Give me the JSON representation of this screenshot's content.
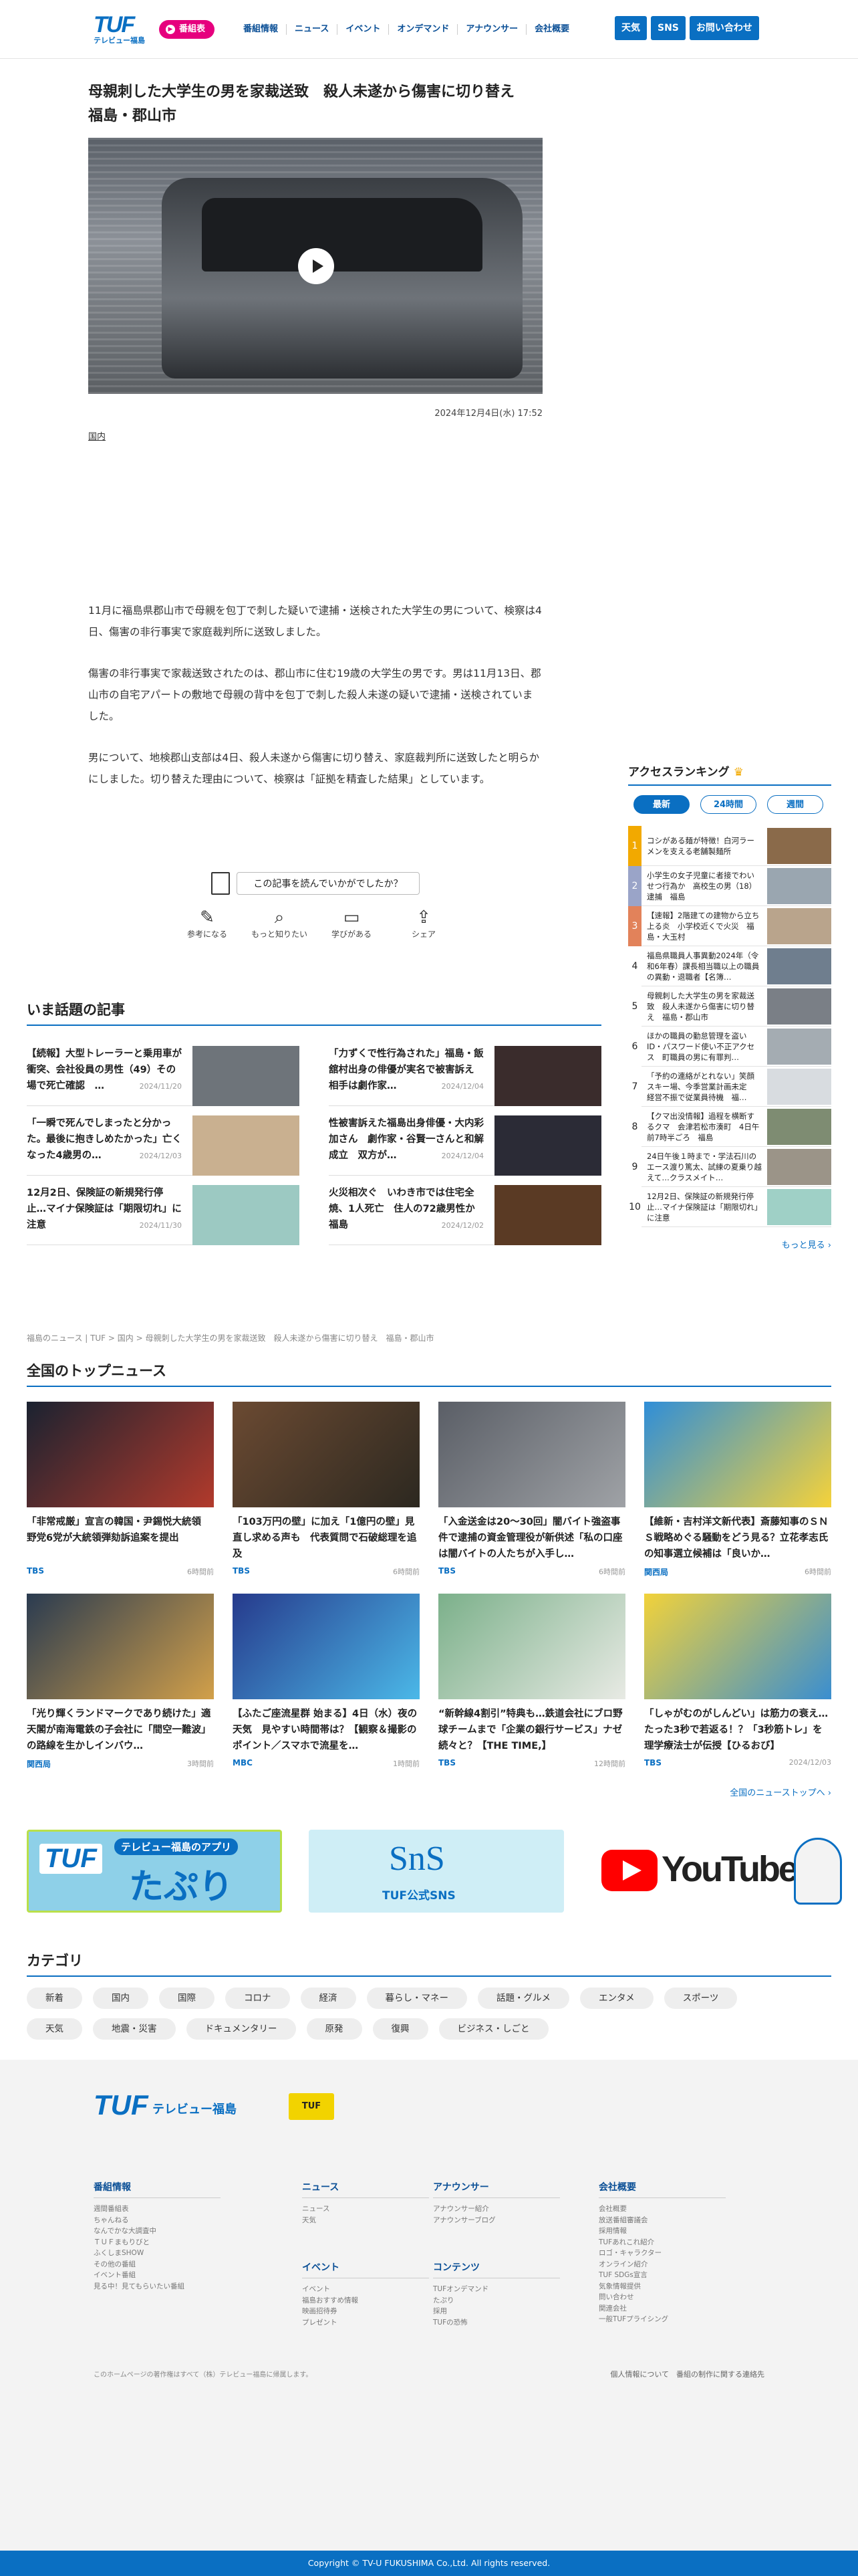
{
  "header": {
    "logo_text": "TUF",
    "logo_sub": "テレビュー福島",
    "program_button": "番組表",
    "nav": [
      "番組情報",
      "ニュース",
      "イベント",
      "オンデマンド",
      "アナウンサー",
      "会社概要"
    ],
    "buttons": [
      "天気",
      "SNS",
      "お問い合わせ"
    ]
  },
  "article": {
    "title": "母親刺した大学生の男を家裁送致　殺人未遂から傷害に切り替え　福島・郡山市",
    "date": "2024年12月4日(水) 17:52",
    "tag": "国内",
    "paragraphs": [
      "11月に福島県郡山市で母親を包丁で刺した疑いで逮捕・送検された大学生の男について、検察は4日、傷害の非行事実で家庭裁判所に送致しました。",
      "傷害の非行事実で家裁送致されたのは、郡山市に住む19歳の大学生の男です。男は11月13日、郡山市の自宅アパートの敷地で母親の背中を包丁で刺した殺人未遂の疑いで逮捕・送検されていました。",
      "男について、地検郡山支部は4日、殺人未遂から傷害に切り替え、家庭裁判所に送致したと明らかにしました。切り替えた理由について、検察は「証拠を精査した結果」としています。"
    ]
  },
  "reaction": {
    "question": "この記事を読んでいかがでしたか？",
    "options": [
      "参考になる",
      "もっと知りたい",
      "学びがある",
      "シェア"
    ]
  },
  "hot": {
    "title": "いま話題の記事",
    "items": [
      {
        "text": "【続報】大型トレーラーと乗用車が衝突、会社役員の男性（49）その場で死亡確認　…",
        "date": "2024/11/20"
      },
      {
        "text": "「力ずくで性行為された」福島・飯舘村出身の俳優が実名で被害訴え　相手は劇作家…",
        "date": "2024/12/04"
      },
      {
        "text": "「一瞬で死んでしまったと分かった。最後に抱きしめたかった」亡くなった4歳男の…",
        "date": "2024/12/03"
      },
      {
        "text": "性被害訴えた福島出身俳優・大内彩加さん　劇作家・谷賢一さんと和解成立　双方が…",
        "date": "2024/12/04"
      },
      {
        "text": "12月2日、保険証の新規発行停止…マイナ保険証は「期限切れ」に注意",
        "date": "2024/11/30"
      },
      {
        "text": "火災相次ぐ　いわき市では住宅全焼、1人死亡　住人の72歳男性か　福島",
        "date": "2024/12/02"
      }
    ]
  },
  "breadcrumb": "福島のニュース | TUF > 国内 > 母親刺した大学生の男を家裁送致　殺人未遂から傷害に切り替え　福島・郡山市",
  "ranking": {
    "title": "アクセスランキング",
    "tabs": [
      "最新",
      "24時間",
      "週間"
    ],
    "items": [
      {
        "n": "1",
        "text": "コシがある麺が特徴！白河ラーメンを支える老舗製麺所",
        "color": "#f2a900"
      },
      {
        "n": "2",
        "text": "小学生の女子児童に者接でわいせつ行為か　高校生の男（18）逮捕　福島",
        "color": "#9aa4c8"
      },
      {
        "n": "3",
        "text": "【速報】2階建ての建物から立ち上る炎　小学校近くで火災　福島・大玉村",
        "color": "#e2825a"
      },
      {
        "n": "4",
        "text": "福島県職員人事異動2024年（令和6年春）課長相当職以上の職員の異動・退職者【名簿…",
        "color": "#fff"
      },
      {
        "n": "5",
        "text": "母親刺した大学生の男を家裁送致　殺人未遂から傷害に切り替え　福島・郡山市",
        "color": "#fff"
      },
      {
        "n": "6",
        "text": "ほかの職員の勤怠管理を盗いID・パスワード使い不正アクセス　町職員の男に有罪判…",
        "color": "#fff"
      },
      {
        "n": "7",
        "text": "「予約の連絡がとれない」笑顔スキー場、今季営業計画未定　経営不振で従業員待機　福…",
        "color": "#fff"
      },
      {
        "n": "8",
        "text": "【クマ出没情報】過程を横断するクマ　会津若松市湊町　4日午前7時半ごろ　福島",
        "color": "#fff"
      },
      {
        "n": "9",
        "text": "24日午後１時まで・学法石川のエース渡り篤太、試練の夏乗り越えて…クラスメイト…",
        "color": "#fff"
      },
      {
        "n": "10",
        "text": "12月2日、保険証の新規発行停止…マイナ保険証は「期限切れ」に注意",
        "color": "#fff"
      }
    ],
    "more": "もっと見る"
  },
  "top_news": {
    "title": "全国のトップニュース",
    "items": [
      {
        "text": "「非常戒厳」宣言の韓国・尹錫悦大統領　野党6党が大統領弾劾訴追案を提出",
        "src": "TBS",
        "time": "6時間前",
        "c1": "#1a2230",
        "c2": "#b23a2c"
      },
      {
        "text": "「103万円の壁」に加え「1億円の壁」見直し求める声も　代表質問で石破総理を追及",
        "src": "TBS",
        "time": "6時間前",
        "c1": "#6b4a32",
        "c2": "#2c2820"
      },
      {
        "text": "「入金送金は20～30回」闇バイト強盗事件で逮捕の資金管理役が新供述「私の口座は闇バイトの人たちが入手し…",
        "src": "TBS",
        "time": "6時間前",
        "c1": "#5a5e66",
        "c2": "#9fa2a6"
      },
      {
        "text": "【維新・吉村洋文新代表】斎藤知事のＳＮＳ戦略めぐる騒動をどう見る？立花孝志氏の知事選立候補は「良いか…",
        "src": "関西局",
        "time": "6時間前",
        "c1": "#2f8ed8",
        "c2": "#f5d23a"
      },
      {
        "text": "「光り輝くランドマークであり続けた」適天閣が南海電鉄の子会社に「間空一難波」の路線を生かしインバウ…",
        "src": "関西局",
        "time": "3時間前",
        "c1": "#2a3b50",
        "c2": "#d2a04a"
      },
      {
        "text": "【ふたご座流星群 始まる】4日（水）夜の天気　見やすい時間帯は？【観察＆撮影のポイント／スマホで流星を…",
        "src": "MBC",
        "time": "1時間前",
        "c1": "#263a8c",
        "c2": "#4bb8e8"
      },
      {
        "text": "“新幹線4割引”特典も…鉄道会社にブロ野球チームまで「企業の銀行サービス」ナゼ続々と？【THE TIME,】",
        "src": "TBS",
        "time": "12時間前",
        "c1": "#7bb08a",
        "c2": "#e8eae4"
      },
      {
        "text": "「しゃがむのがしんどい」は筋力の衰え…たった3秒で若返る！？「3秒筋トレ」を理学療法士が伝授【ひるおび】",
        "src": "TBS",
        "time": "2024/12/03",
        "c1": "#f2d23a",
        "c2": "#3a8ed0"
      }
    ],
    "more": "全国のニューストップへ"
  },
  "banners": {
    "app_label": "テレビュー福島のアプリ",
    "app_name": "たぷり",
    "sns_title": "SnS",
    "sns_sub": "TUF公式SNS",
    "youtube": "YouTube"
  },
  "categories": {
    "title": "カテゴリ",
    "items": [
      "新着",
      "国内",
      "国際",
      "コロナ",
      "経済",
      "暮らし・マネー",
      "話題・グルメ",
      "エンタメ",
      "スポーツ",
      "天気",
      "地震・災害",
      "ドキュメンタリー",
      "原発",
      "復興",
      "ビジネス・しごと"
    ]
  },
  "footer": {
    "logo": "TUF",
    "logo_sub": "テレビュー福島",
    "badge": "TUF",
    "cols": [
      {
        "title": "番組情報",
        "links": [
          "週間番組表",
          "ちゃんねる",
          "なんでかな大調査中",
          "ＴＵＦまもりびと",
          "ふくしまSHOW",
          "その他の番組",
          "イベント番組",
          "見る中！見てもらいたい番組"
        ]
      },
      {
        "title": "ニュース",
        "links": [
          "ニュース",
          "天気"
        ]
      },
      {
        "title": "イベント",
        "links": [
          "イベント",
          "福島おすすめ情報",
          "映画招待券",
          "プレゼント"
        ]
      },
      {
        "title": "アナウンサー",
        "links": [
          "アナウンサー紹介",
          "アナウンサーブログ"
        ]
      },
      {
        "title": "コンテンツ",
        "links": [
          "TUFオンデマンド",
          "たぷり",
          "採用",
          "TUFの恐怖"
        ]
      },
      {
        "title": "会社概要",
        "links": [
          "会社概要",
          "放送番組審議会",
          "採用情報",
          "TUFあれこれ紹介",
          "ロゴ・キャラクター",
          "オンライン紹介",
          "TUF SDGs宣言",
          "気象情報提供",
          "問い合わせ",
          "関連会社",
          "一般TUFプライシング"
        ]
      }
    ],
    "note": "このホームページの著作権はすべて（株）テレビュー福島に帰属します。",
    "links": "個人情報について　番組の制作に関する連絡先",
    "copyright": "Copyright © TV-U FUKUSHIMA Co.,Ltd. All rights reserved."
  }
}
